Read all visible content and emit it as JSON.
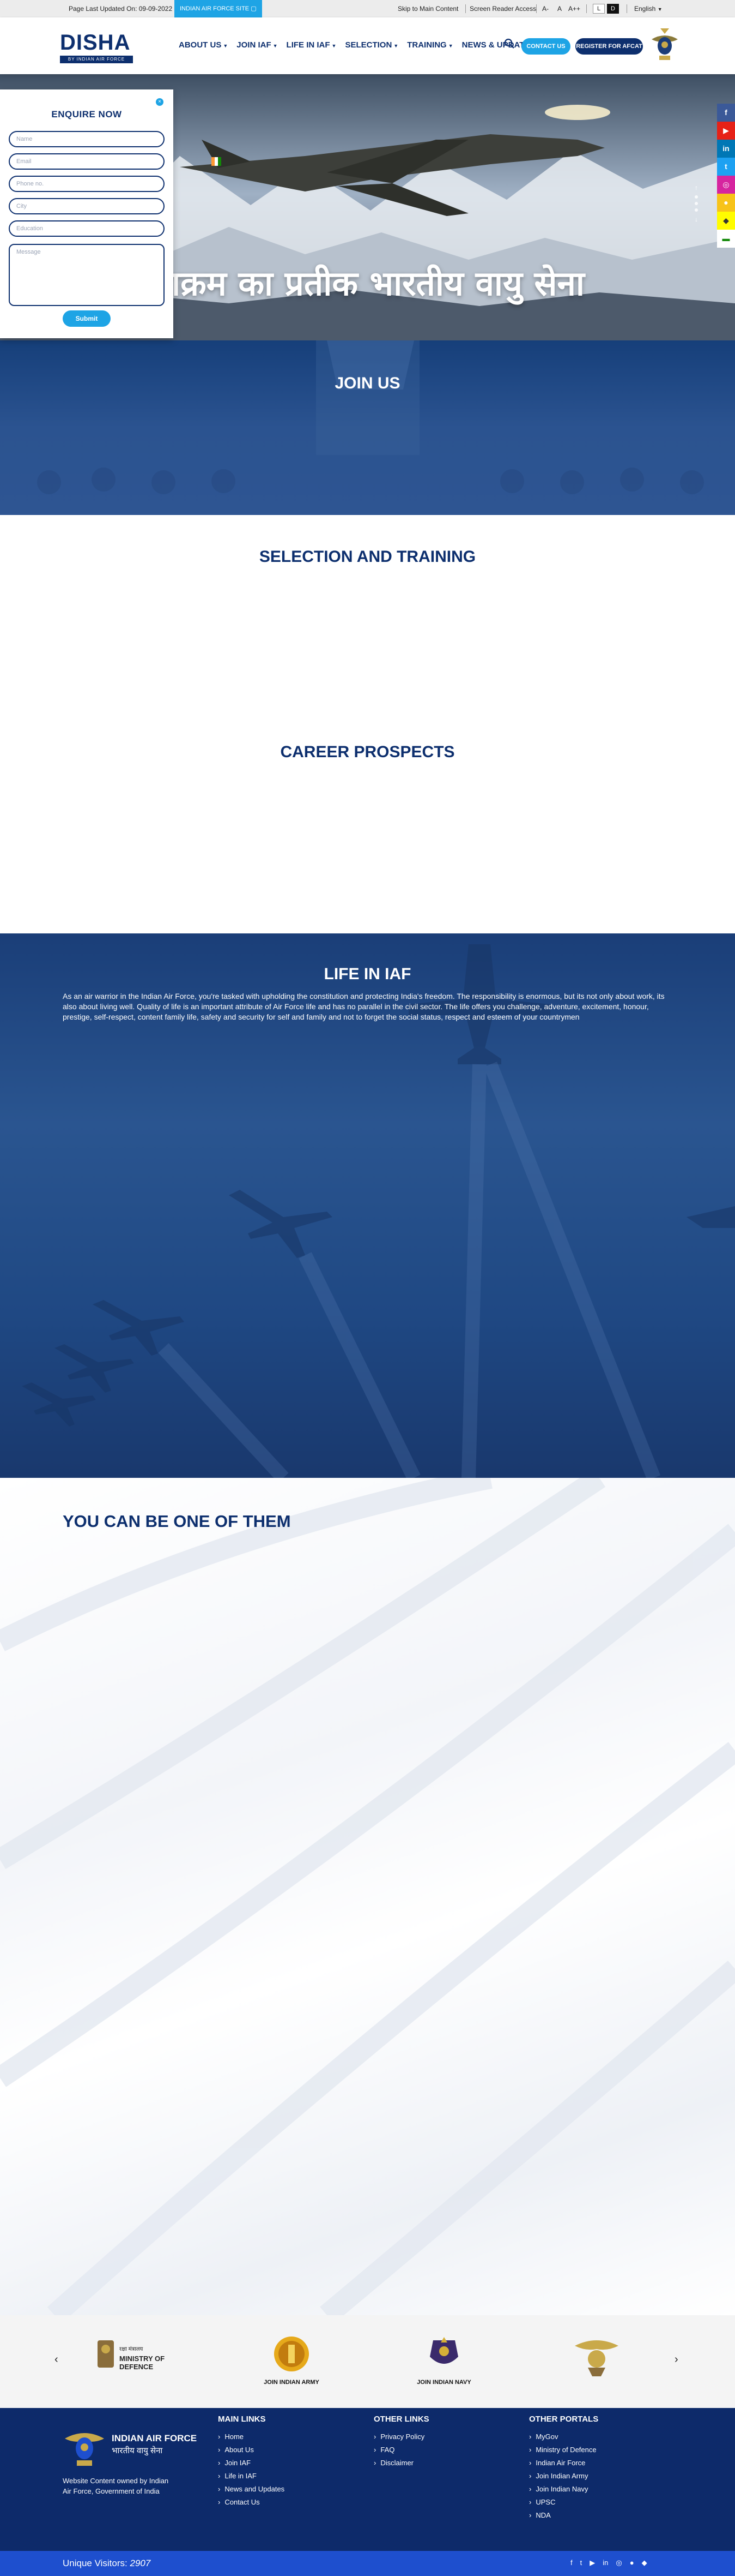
{
  "topbar": {
    "last_updated": "Page Last Updated On: 09-09-2022",
    "marquee": "INDIAN AIR FORCE SITE",
    "skip": "Skip to Main Content",
    "screen_reader": "Screen Reader Access",
    "font_small": "A-",
    "font_normal": "A",
    "font_large": "A++",
    "contrast_light": "L",
    "contrast_dark": "D",
    "language": "English"
  },
  "header": {
    "logo_text": "DISHA",
    "logo_tag": "BY INDIAN AIR FORCE",
    "nav": [
      {
        "label": "ABOUT US"
      },
      {
        "label": "JOIN IAF"
      },
      {
        "label": "LIFE IN IAF"
      },
      {
        "label": "SELECTION"
      },
      {
        "label": "TRAINING"
      },
      {
        "label": "NEWS & UPDATES"
      }
    ],
    "contact_button": "CONTACT US",
    "register_button": "REGISTER FOR AFCAT"
  },
  "hero": {
    "title": "ौं पराक्रम का प्रतीक भारतीय वायु सेना"
  },
  "enquire": {
    "title": "ENQUIRE NOW",
    "fields": {
      "name": "Name",
      "email": "Email",
      "phone": "Phone no.",
      "city": "City",
      "education": "Education",
      "message": "Message"
    },
    "submit": "Submit"
  },
  "sections": {
    "join_us": "JOIN US",
    "selection_training": "SELECTION AND TRAINING",
    "career_prospects": "CAREER PROSPECTS",
    "life_in_iaf": "LIFE IN IAF",
    "life_text": "As an air warrior in the Indian Air Force, you're tasked with upholding the constitution and protecting India's freedom. The responsibility is enormous, but its not only about work, its also about living well. Quality of life is an important attribute of Air Force life and has no parallel in the civil sector. The life offers you challenge, adventure, excitement, honour, prestige, self-respect, content family life, safety and security for self and family and not to forget the social status, respect and esteem of your countrymen",
    "one_of_them": "YOU CAN BE ONE OF THEM"
  },
  "partners": {
    "items": [
      {
        "label": "MINISTRY OF DEFENCE",
        "hindi": "रक्षा मंत्रालय"
      },
      {
        "label": "JOIN INDIAN ARMY"
      },
      {
        "label": "JOIN INDIAN NAVY"
      },
      {
        "label": ""
      }
    ]
  },
  "footer": {
    "brand_name": "INDIAN AIR FORCE",
    "brand_hindi": "भारतीय वायु सेना",
    "brand_desc": "Website Content owned by Indian Air Force, Government of India",
    "main_links_title": "MAIN LINKS",
    "main_links": [
      "Home",
      "About Us",
      "Join IAF",
      "Life in IAF",
      "News and Updates",
      "Contact Us"
    ],
    "other_links_title": "OTHER LINKS",
    "other_links": [
      "Privacy Policy",
      "FAQ",
      "Disclaimer"
    ],
    "other_portals_title": "OTHER PORTALS",
    "other_portals": [
      "MyGov",
      "Ministry of Defence",
      "Indian Air Force",
      "Join Indian Army",
      "Join Indian Navy",
      "UPSC",
      "NDA"
    ],
    "visitors_label": "Unique Visitors:",
    "visitors_count": "2907"
  },
  "colors": {
    "primary": "#0d2f6e",
    "accent": "#1ea4e5",
    "footer_bar": "#1e4fce"
  }
}
